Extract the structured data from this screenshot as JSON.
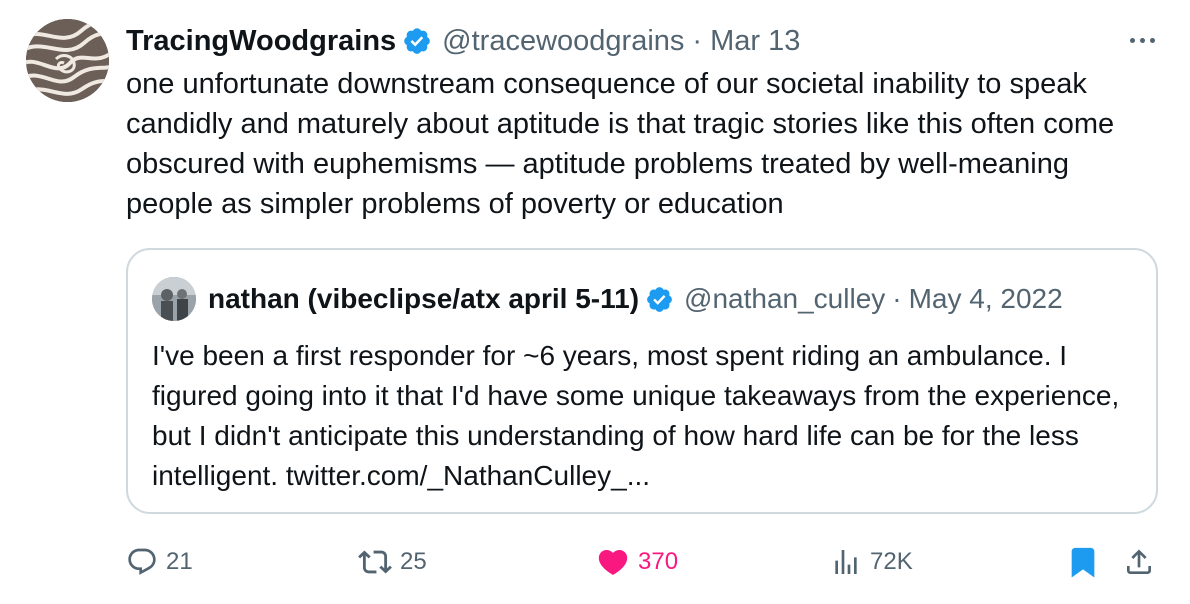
{
  "tweet": {
    "author": {
      "name": "TracingWoodgrains",
      "handle": "@tracewoodgrains",
      "verified": true,
      "avatar_icon": "wood-grain-avatar"
    },
    "separator": "·",
    "date": "Mar 13",
    "more_icon": "more-horizontal-icon",
    "text": "one unfortunate downstream consequence of our societal inability to speak candidly and maturely about aptitude is that tragic stories like this often come obscured with euphemisms — aptitude problems treated by well-meaning people as simpler problems of poverty or education"
  },
  "quoted_tweet": {
    "author": {
      "name": "nathan (vibeclipse/atx april 5-11)",
      "handle": "@nathan_culley",
      "verified": true,
      "avatar_icon": "user-photo-avatar"
    },
    "separator": "·",
    "date": "May 4, 2022",
    "text": "I've been a first responder for ~6 years, most spent riding an ambulance. I figured going into it that I'd have some unique takeaways from the experience, but I didn't anticipate this understanding of how hard life can be for the less intelligent. twitter.com/_NathanCulley_..."
  },
  "actions": {
    "replies": "21",
    "retweets": "25",
    "likes": "370",
    "views": "72K",
    "liked": true,
    "bookmarked": true
  },
  "colors": {
    "text_primary": "#0f1419",
    "text_secondary": "#536471",
    "verified_blue": "#1d9bf0",
    "like_pink": "#f91880",
    "border": "#cfd9de"
  }
}
